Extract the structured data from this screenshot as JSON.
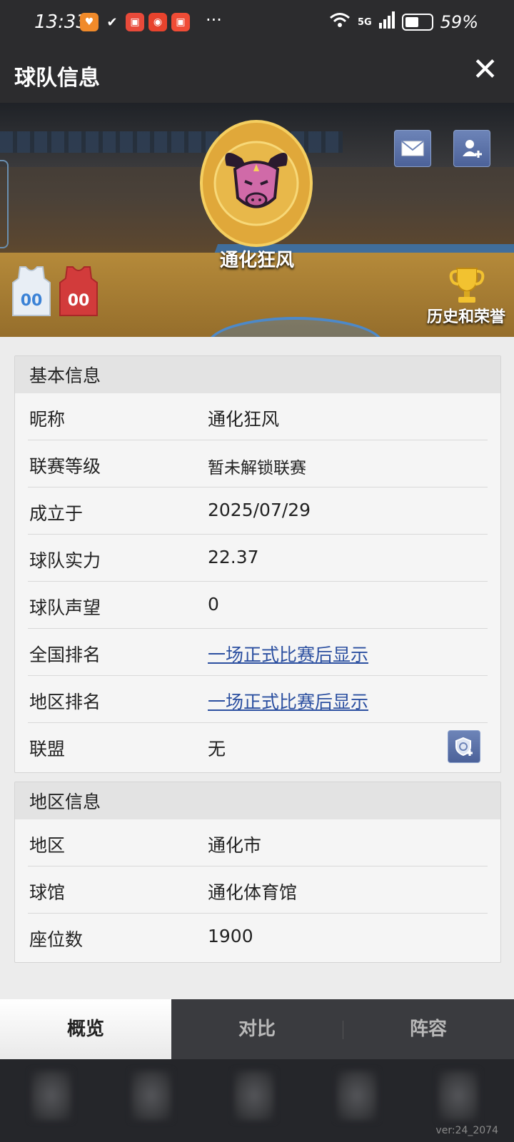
{
  "status_bar": {
    "time": "13:33",
    "signal_label": "5G",
    "battery": "59%",
    "battery_level": 0.59
  },
  "header": {
    "title": "球队信息",
    "close_symbol": "✕"
  },
  "banner": {
    "team_name": "通化狂风",
    "history_label": "历史和荣誉",
    "jersey_number": "00"
  },
  "basic_info": {
    "title": "基本信息",
    "rows": [
      {
        "label": "昵称",
        "value": "通化狂风"
      },
      {
        "label": "联赛等级",
        "value": "暂未解锁联赛"
      },
      {
        "label": "成立于",
        "value": "2025/07/29"
      },
      {
        "label": "球队实力",
        "value": "22.37"
      },
      {
        "label": "球队声望",
        "value": "0"
      },
      {
        "label": "全国排名",
        "value": "一场正式比赛后显示"
      },
      {
        "label": "地区排名",
        "value": "一场正式比赛后显示"
      },
      {
        "label": "联盟",
        "value": "无"
      }
    ]
  },
  "region_info": {
    "title": "地区信息",
    "rows": [
      {
        "label": "地区",
        "value": "通化市"
      },
      {
        "label": "球馆",
        "value": "通化体育馆"
      },
      {
        "label": "座位数",
        "value": "1900"
      }
    ]
  },
  "tabs": [
    {
      "label": "概览",
      "active": true
    },
    {
      "label": "对比",
      "active": false
    },
    {
      "label": "阵容",
      "active": false
    }
  ],
  "version": "ver:24_2074",
  "colors": {
    "accent": "#4c6299",
    "link": "#2b4fa0",
    "header_bg": "#2c2c2e",
    "logo_gold": "#e0a83a"
  }
}
